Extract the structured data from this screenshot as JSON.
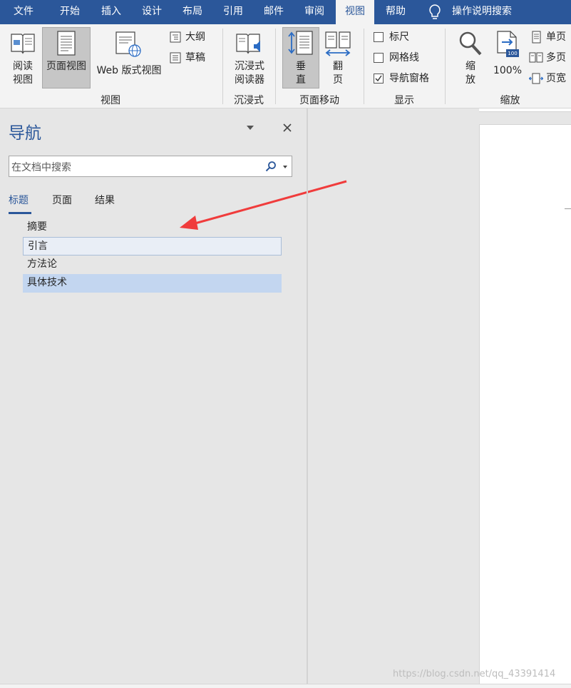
{
  "menu": {
    "items": [
      "文件",
      "开始",
      "插入",
      "设计",
      "布局",
      "引用",
      "邮件",
      "审阅",
      "视图",
      "帮助"
    ],
    "active": "视图",
    "tell_me": "操作说明搜索"
  },
  "ribbon": {
    "views": {
      "read_mode_line1": "阅读",
      "read_mode_line2": "视图",
      "print_layout": "页面视图",
      "web_layout": "Web 版式视图",
      "outline": "大纲",
      "draft": "草稿",
      "group_label": "视图"
    },
    "immersive": {
      "reader_line1": "沉浸式",
      "reader_line2": "阅读器",
      "group_label": "沉浸式"
    },
    "page_movement": {
      "vertical_line1": "垂",
      "vertical_line2": "直",
      "side_line1": "翻",
      "side_line2": "页",
      "group_label": "页面移动"
    },
    "show": {
      "ruler": "标尺",
      "gridlines": "网格线",
      "nav_pane": "导航窗格",
      "ruler_checked": false,
      "gridlines_checked": false,
      "nav_pane_checked": true,
      "group_label": "显示"
    },
    "zoom": {
      "zoom_line1": "缩",
      "zoom_line2": "放",
      "percent": "100%",
      "percent_badge": "100",
      "one_page": "单页",
      "multiple_pages": "多页",
      "page_width": "页宽",
      "group_label": "缩放"
    }
  },
  "nav": {
    "title": "导航",
    "search_placeholder": "在文档中搜索",
    "tabs": [
      "标题",
      "页面",
      "结果"
    ],
    "active_tab": "标题",
    "headings": [
      "摘要",
      "引言",
      "方法论",
      "具体技术"
    ],
    "selected_heading": "具体技术",
    "hover_heading": "引言"
  },
  "colors": {
    "brand": "#2b579a",
    "selection": "#c3d6f0",
    "arrow": "#f03c3c"
  },
  "watermark": "https://blog.csdn.net/qq_43391414"
}
